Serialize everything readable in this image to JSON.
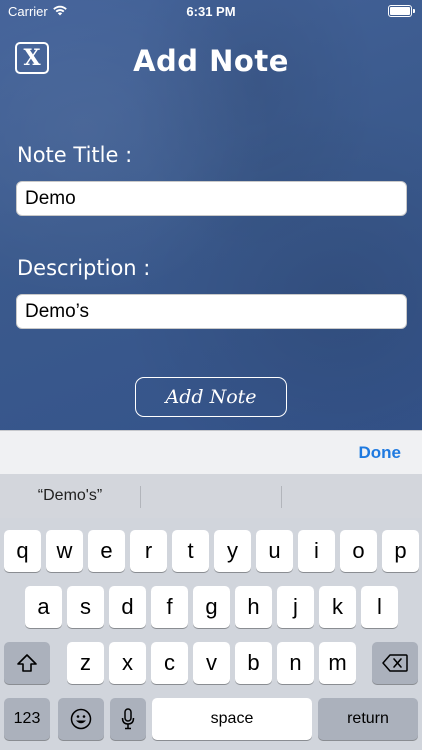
{
  "status_bar": {
    "carrier": "Carrier",
    "time": "6:31 PM",
    "wifi_icon": "wifi-icon",
    "battery_icon": "battery-icon"
  },
  "header": {
    "close_label": "X",
    "title": "Add Note"
  },
  "form": {
    "title_label": "Note Title :",
    "title_value": "Demo",
    "description_label": "Description :",
    "description_value": "Demo’s",
    "submit_label": "Add Note"
  },
  "keyboard": {
    "done_label": "Done",
    "suggestions": [
      "“Demo's”",
      "",
      ""
    ],
    "row1": [
      "q",
      "w",
      "e",
      "r",
      "t",
      "y",
      "u",
      "i",
      "o",
      "p"
    ],
    "row2": [
      "a",
      "s",
      "d",
      "f",
      "g",
      "h",
      "j",
      "k",
      "l"
    ],
    "row3": [
      "z",
      "x",
      "c",
      "v",
      "b",
      "n",
      "m"
    ],
    "shift_icon": "shift-icon",
    "delete_icon": "backspace-icon",
    "numbers_label": "123",
    "emoji_icon": "emoji-icon",
    "mic_icon": "microphone-icon",
    "space_label": "space",
    "return_label": "return"
  },
  "colors": {
    "background": "#3c5a8a",
    "done": "#1f7ae0",
    "keyboard": "#d1d5dc",
    "dark_key": "#abb1bc"
  }
}
